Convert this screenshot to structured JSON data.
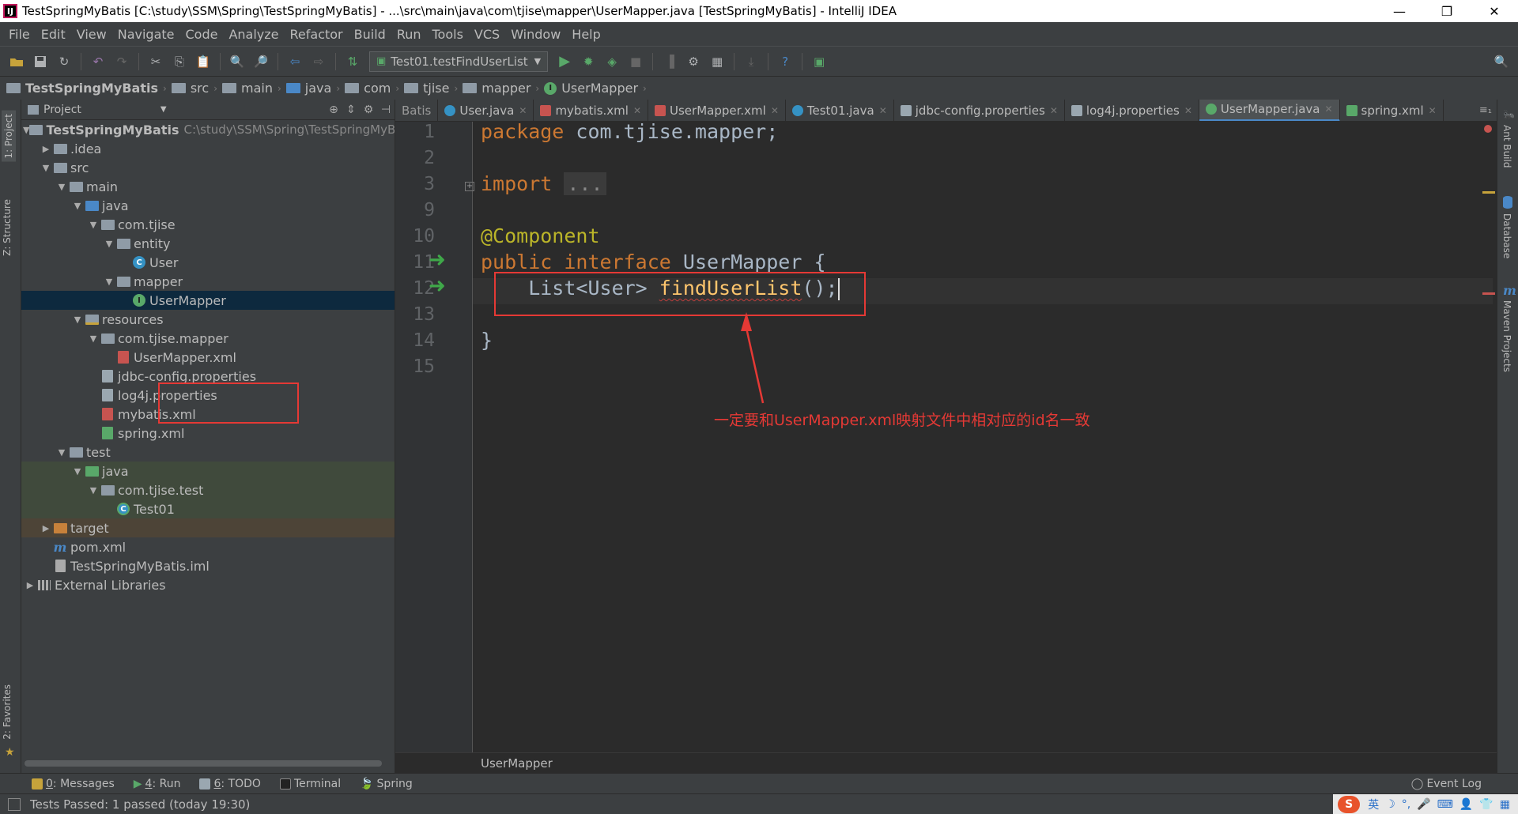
{
  "window": {
    "title": "TestSpringMyBatis [C:\\study\\SSM\\Spring\\TestSpringMyBatis] - ...\\src\\main\\java\\com\\tjise\\mapper\\UserMapper.java [TestSpringMyBatis] - IntelliJ IDEA",
    "app_icon": "IJ",
    "minimize": "—",
    "maximize": "❐",
    "close": "✕"
  },
  "menu": [
    "File",
    "Edit",
    "View",
    "Navigate",
    "Code",
    "Analyze",
    "Refactor",
    "Build",
    "Run",
    "Tools",
    "VCS",
    "Window",
    "Help"
  ],
  "toolbar": {
    "run_config": "Test01.testFindUserList"
  },
  "breadcrumb": [
    "TestSpringMyBatis",
    "src",
    "main",
    "java",
    "com",
    "tjise",
    "mapper",
    "UserMapper"
  ],
  "project_panel": {
    "title": "Project",
    "tree": [
      {
        "label": "TestSpringMyBatis",
        "hint": "C:\\study\\SSM\\Spring\\TestSpringMyBa"
      },
      {
        "label": ".idea"
      },
      {
        "label": "src"
      },
      {
        "label": "main"
      },
      {
        "label": "java"
      },
      {
        "label": "com.tjise"
      },
      {
        "label": "entity"
      },
      {
        "label": "User"
      },
      {
        "label": "mapper"
      },
      {
        "label": "UserMapper"
      },
      {
        "label": "resources"
      },
      {
        "label": "com.tjise.mapper"
      },
      {
        "label": "UserMapper.xml"
      },
      {
        "label": "jdbc-config.properties"
      },
      {
        "label": "log4j.properties"
      },
      {
        "label": "mybatis.xml"
      },
      {
        "label": "spring.xml"
      },
      {
        "label": "test"
      },
      {
        "label": "java"
      },
      {
        "label": "com.tjise.test"
      },
      {
        "label": "Test01"
      },
      {
        "label": "target"
      },
      {
        "label": "pom.xml"
      },
      {
        "label": "TestSpringMyBatis.iml"
      },
      {
        "label": "External Libraries"
      }
    ]
  },
  "left_stripe": {
    "project": "1: Project",
    "structure": "Z: Structure",
    "favorites": "2: Favorites"
  },
  "right_stripe": {
    "ant": "Ant Build",
    "database": "Database",
    "maven": "Maven Projects"
  },
  "editor_tabs": [
    {
      "label": "Batis",
      "icon": "none"
    },
    {
      "label": "User.java",
      "icon": "c"
    },
    {
      "label": "mybatis.xml",
      "icon": "x"
    },
    {
      "label": "UserMapper.xml",
      "icon": "x"
    },
    {
      "label": "Test01.java",
      "icon": "c"
    },
    {
      "label": "jdbc-config.properties",
      "icon": "p"
    },
    {
      "label": "log4j.properties",
      "icon": "p"
    },
    {
      "label": "UserMapper.java",
      "icon": "i"
    },
    {
      "label": "spring.xml",
      "icon": "x"
    }
  ],
  "tabs_more": "≡₁",
  "editor": {
    "line_numbers": [
      "1",
      "2",
      "3",
      "9",
      "10",
      "11",
      "12",
      "13",
      "14",
      "15"
    ],
    "code": {
      "l1_kw": "package",
      "l1_rest": " com.tjise.mapper;",
      "l3_kw": "import",
      "l3_fold": "...",
      "l10_ann": "@Component",
      "l11_kw1": "public",
      "l11_kw2": "interface",
      "l11_rest": " UserMapper {",
      "l12_indent": "    List<User> ",
      "l12_fn": "findUserList",
      "l12_rest": "();",
      "l14": "}"
    },
    "annotation_note": "一定要和UserMapper.xml映射文件中相对应的id名一致",
    "footer_crumb": "UserMapper"
  },
  "bottom_tools": [
    {
      "num": "0",
      "label": ": Messages",
      "color": "#c7a33b"
    },
    {
      "num": "4",
      "label": ": Run",
      "color": "#59a869"
    },
    {
      "num": "6",
      "label": ": TODO",
      "color": "#9aa7b0"
    },
    {
      "num": "",
      "label": "Terminal",
      "color": "#555555"
    },
    {
      "num": "",
      "label": "Spring",
      "color": "#59a869"
    }
  ],
  "event_log": "Event Log",
  "status": {
    "text": "Tests Passed: 1 passed (today 19:30)"
  },
  "tray": {
    "ime": "S",
    "lang": "英"
  },
  "colors": {
    "accent": "#4a88c7",
    "annotation_red": "#e53935",
    "run_green": "#59a869"
  }
}
